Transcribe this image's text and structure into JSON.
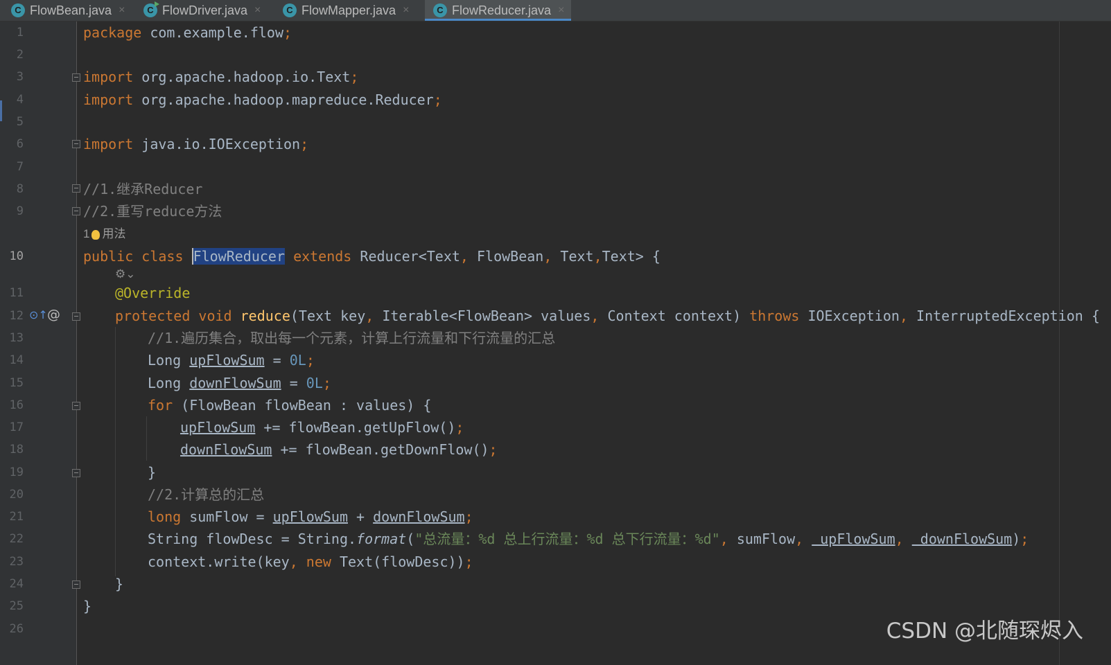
{
  "tabs": [
    {
      "label": "FlowBean.java",
      "icon": "class-icon",
      "active": false
    },
    {
      "label": "FlowDriver.java",
      "icon": "runnable-class-icon",
      "active": false
    },
    {
      "label": "FlowMapper.java",
      "icon": "class-icon",
      "active": false
    },
    {
      "label": "FlowReducer.java",
      "icon": "class-icon",
      "active": true
    }
  ],
  "tab_icon_letter": "C",
  "close_glyph": "×",
  "line_numbers": [
    "1",
    "2",
    "3",
    "4",
    "5",
    "6",
    "7",
    "8",
    "9",
    "10",
    "11",
    "12",
    "13",
    "14",
    "15",
    "16",
    "17",
    "18",
    "19",
    "20",
    "21",
    "22",
    "23",
    "24",
    "25",
    "26"
  ],
  "code": {
    "l1": {
      "kw": "package",
      "rest": " com.example.flow",
      "semi": ";"
    },
    "l3": {
      "kw": "import",
      "rest": " org.apache.hadoop.io.Text",
      "semi": ";"
    },
    "l4": {
      "kw": "import",
      "rest": " org.apache.hadoop.mapreduce.Reducer",
      "semi": ";"
    },
    "l6": {
      "kw": "import",
      "rest": " java.io.IOException",
      "semi": ";"
    },
    "l8": "//1.继承Reducer",
    "l9": "//2.重写reduce方法",
    "usages_hint": {
      "count": "1",
      "label": "用法"
    },
    "l10": {
      "kw1": "public",
      "kw2": "class",
      "name": "FlowReducer",
      "kw3": "extends",
      "sig": "Reducer<Text",
      "c1": ",",
      "t2": " FlowBean",
      "c2": ",",
      "t3": " Text",
      "c3": ",",
      "t4": "Text> {"
    },
    "gear_hint": "⚙⌄",
    "l11": "@Override",
    "l12": {
      "kw": "protected",
      "kw2": "void",
      "fn": "reduce",
      "p1": "(Text key",
      "c1": ",",
      "p2": " Iterable<FlowBean> values",
      "c2": ",",
      "p3": " Context context) ",
      "kw3": "throws",
      "p4": " IOException",
      "c3": ",",
      "p5": " InterruptedException {"
    },
    "l13": "//1.遍历集合，取出每一个元素，计算上行流量和下行流量的汇总",
    "l14": {
      "type": "Long ",
      "var": "upFlowSum",
      "eq": " = ",
      "num": "0L",
      "semi": ";"
    },
    "l15": {
      "type": "Long ",
      "var": "downFlowSum",
      "eq": " = ",
      "num": "0L",
      "semi": ";"
    },
    "l16": {
      "kw": "for",
      "rest": " (FlowBean flowBean : values) {"
    },
    "l17": {
      "var": "upFlowSum",
      "rest": " += flowBean.getUpFlow()",
      "semi": ";"
    },
    "l18": {
      "var": "downFlowSum",
      "rest": " += flowBean.getDownFlow()",
      "semi": ";"
    },
    "l19": "}",
    "l20": "//2.计算总的汇总",
    "l21": {
      "kw": "long",
      "rest": " sumFlow = ",
      "v1": "upFlowSum",
      "plus": " + ",
      "v2": "downFlowSum",
      "semi": ";"
    },
    "l22": {
      "pre": "String flowDesc = String.",
      "fmt": "format",
      "open": "(",
      "str": "\"总流量：%d 总上行流量：%d 总下行流量：%d\"",
      "c1": ",",
      "mid": " sumFlow",
      "c2": ",",
      "v1": " upFlowSum",
      "c3": ",",
      "v2": " downFlowSum",
      "end": ")",
      "semi": ";"
    },
    "l23": {
      "pre": "context.write(key",
      "c1": ",",
      "kw": " new",
      "rest": " Text(flowDesc))",
      "semi": ";"
    },
    "l24": "}",
    "l25": "}"
  },
  "gutter_icons": {
    "override": "⊙↑",
    "at": "@"
  },
  "watermark": "CSDN @北随琛烬入",
  "colors": {
    "background": "#2b2b2b",
    "keyword": "#cc7832",
    "comment": "#808080",
    "annotation": "#bbb529",
    "method": "#ffc66d",
    "number": "#6897bb",
    "string": "#6a8759",
    "text": "#a9b7c6",
    "selection": "#214283",
    "tab_underline": "#4a88c7"
  }
}
